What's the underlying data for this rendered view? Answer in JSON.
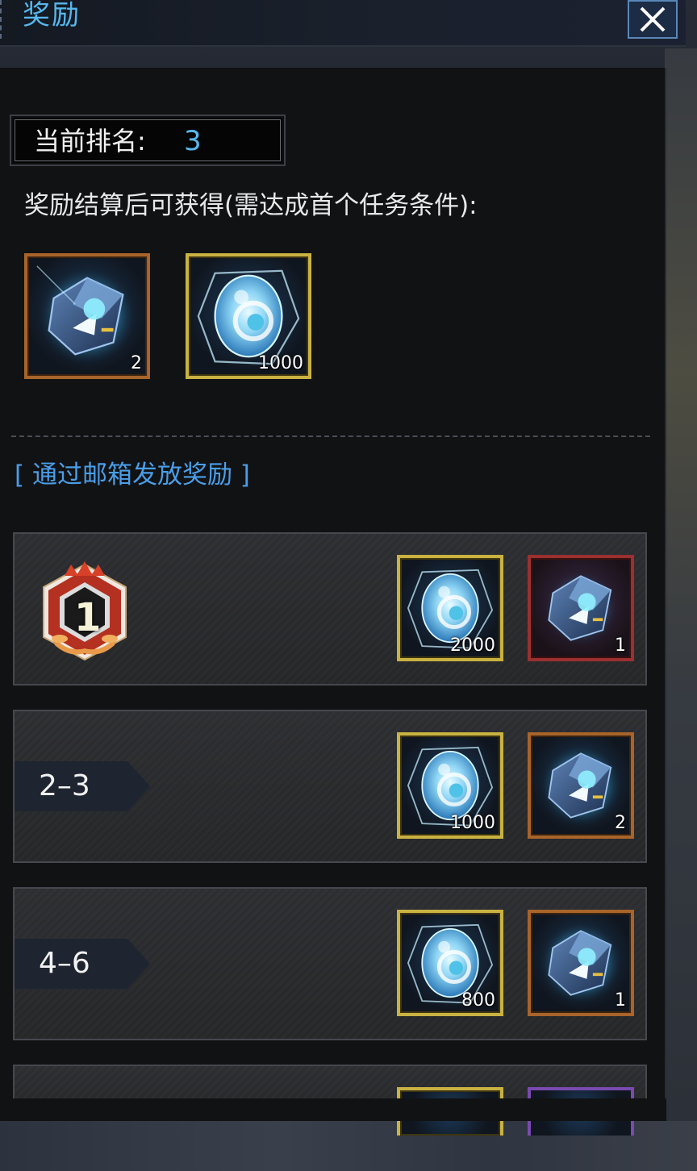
{
  "header": {
    "title": "奖励"
  },
  "current_rank": {
    "label": "当前排名:",
    "value": "3"
  },
  "settlement_note": "奖励结算后可获得(需达成首个任务条件):",
  "current_rewards": [
    {
      "icon": "crystal-cube-icon",
      "frame": "orange",
      "qty": "2"
    },
    {
      "icon": "crystal-gem-icon",
      "frame": "gold",
      "qty": "1000"
    }
  ],
  "mail_section_label": "[ 通过邮箱发放奖励 ]",
  "tiers": [
    {
      "badge": "1",
      "range": "",
      "rewards": [
        {
          "icon": "crystal-gem-icon",
          "frame": "gold",
          "qty": "2000"
        },
        {
          "icon": "crystal-cube-icon",
          "frame": "red",
          "qty": "1"
        }
      ]
    },
    {
      "range": "2–3",
      "rewards": [
        {
          "icon": "crystal-gem-icon",
          "frame": "gold",
          "qty": "1000"
        },
        {
          "icon": "crystal-cube-icon",
          "frame": "orange",
          "qty": "2"
        }
      ]
    },
    {
      "range": "4–6",
      "rewards": [
        {
          "icon": "crystal-gem-icon",
          "frame": "gold",
          "qty": "800"
        },
        {
          "icon": "crystal-cube-icon",
          "frame": "orange",
          "qty": "1"
        }
      ]
    }
  ],
  "colors": {
    "accent_blue": "#56b8ee",
    "frame_gold": "#c9b242",
    "frame_orange": "#a8642a",
    "frame_red": "#9a3030",
    "frame_purple": "#7a4ab0"
  }
}
